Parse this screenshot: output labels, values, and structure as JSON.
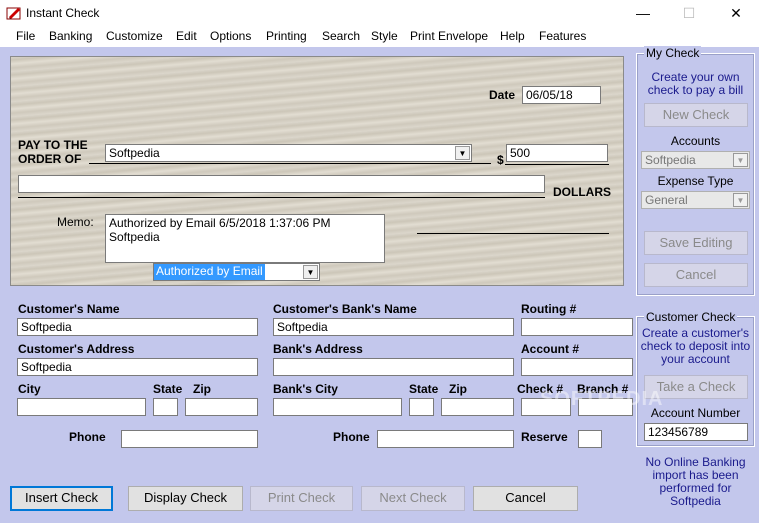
{
  "window": {
    "title": "Instant Check",
    "minimize": "—",
    "maximize": "☐",
    "close": "✕"
  },
  "menu": [
    "File",
    "Banking",
    "Customize",
    "Edit",
    "Options",
    "Printing",
    "Search",
    "Style",
    "Print Envelope",
    "Help",
    "Features"
  ],
  "check": {
    "date_label": "Date",
    "date_value": "06/05/18",
    "pay_to_label_1": "PAY TO THE",
    "pay_to_label_2": "ORDER OF",
    "payee": "Softpedia",
    "dollar_sign": "$",
    "amount": "500",
    "amount_words": "",
    "dollars_label": "DOLLARS",
    "memo_label": "Memo:",
    "memo_line1": "Authorized by Email 6/5/2018 1:37:06 PM",
    "memo_line2": "Softpedia",
    "signature_type": "Authorized by Email"
  },
  "customer": {
    "name_label": "Customer's Name",
    "name_value": "Softpedia",
    "address_label": "Customer's Address",
    "address_value": "Softpedia",
    "city_label": "City",
    "city_value": "",
    "state_label": "State",
    "state_value": "",
    "zip_label": "Zip",
    "zip_value": "",
    "phone_label": "Phone",
    "phone_value": ""
  },
  "bank": {
    "name_label": "Customer's Bank's Name",
    "name_value": "Softpedia",
    "address_label": "Bank's Address",
    "address_value": "",
    "city_label": "Bank's City",
    "city_value": "",
    "state_label": "State",
    "state_value": "",
    "zip_label": "Zip",
    "zip_value": "",
    "phone_label": "Phone",
    "phone_value": ""
  },
  "routing": {
    "routing_label": "Routing #",
    "routing_value": "",
    "account_label": "Account #",
    "account_value": "",
    "check_no_label": "Check #",
    "check_no_value": "",
    "branch_label": "Branch #",
    "branch_value": "",
    "reserve_label": "Reserve",
    "reserve_value": ""
  },
  "my_check": {
    "legend": "My Check",
    "desc_line1": "Create your own",
    "desc_line2": "check to pay a bill",
    "new_check": "New Check",
    "accounts_label": "Accounts",
    "accounts_value": "Softpedia",
    "expense_label": "Expense Type",
    "expense_value": "General",
    "save_editing": "Save Editing",
    "cancel": "Cancel"
  },
  "customer_check": {
    "legend": "Customer Check",
    "desc_line1": "Create a customer's",
    "desc_line2": "check to deposit into",
    "desc_line3": "your account",
    "take_check": "Take a Check",
    "account_number_label": "Account Number",
    "account_number_value": "123456789"
  },
  "status": {
    "line1": "No Online Banking",
    "line2": "import has been",
    "line3": "performed for",
    "line4": "Softpedia"
  },
  "buttons": {
    "insert": "Insert Check",
    "display": "Display Check",
    "print": "Print Check",
    "next": "Next Check",
    "cancel": "Cancel"
  },
  "watermark": "SOFTPEDIA"
}
